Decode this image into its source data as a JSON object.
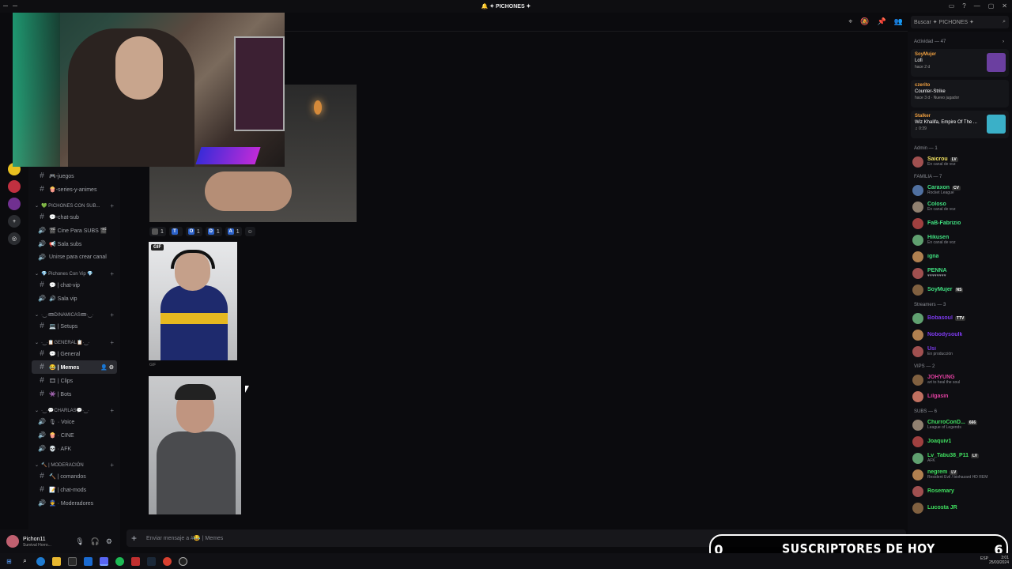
{
  "window": {
    "title": "🔔 ✦ PICHONES ✦",
    "controls": [
      "▭",
      "?",
      "—",
      "▢",
      "✕"
    ]
  },
  "search": {
    "placeholder": "Buscar ✦ PICHONES ✦"
  },
  "channels": [
    {
      "type": "text",
      "label": "🎮-juegos"
    },
    {
      "type": "text",
      "label": "🍿-series-y-animes"
    },
    {
      "type": "category",
      "label": "💚 PICHONES CON SUB..."
    },
    {
      "type": "text",
      "label": "💬-chat-sub"
    },
    {
      "type": "voice",
      "label": "🎬 Cine Para SUBS 🎬"
    },
    {
      "type": "voice",
      "label": "📢 Sala subs"
    },
    {
      "type": "voice",
      "label": "Unirse para crear canal"
    },
    {
      "type": "category",
      "label": "💎 Pichones Con Vip 💎"
    },
    {
      "type": "text",
      "label": "💬 | chat-vip"
    },
    {
      "type": "voice",
      "label": "🔊 Sala vip"
    },
    {
      "type": "category",
      "label": "·‿·🎟DINAMICAS🎟·‿·"
    },
    {
      "type": "text",
      "label": "💻 | Setups"
    },
    {
      "type": "category",
      "label": "·‿·📋GENERAL📋·‿·"
    },
    {
      "type": "text",
      "label": "💬 | General"
    },
    {
      "type": "text",
      "label": "😂 | Memes",
      "active": true
    },
    {
      "type": "text",
      "label": "🎞 | Clips"
    },
    {
      "type": "text",
      "label": "👾 | Bots"
    },
    {
      "type": "category",
      "label": "·‿·💬CHARLAS💬·‿·"
    },
    {
      "type": "voice",
      "label": "🎙 · Voice"
    },
    {
      "type": "voice",
      "label": "🍿 · CINE"
    },
    {
      "type": "voice",
      "label": "💀 · AFK"
    },
    {
      "type": "category",
      "label": "🔨 | MODERACIÓN"
    },
    {
      "type": "text",
      "label": "🔨 | comandos"
    },
    {
      "type": "text",
      "label": "📝 | chat-mods"
    },
    {
      "type": "voice",
      "label": "👮 · Moderadores"
    }
  ],
  "user": {
    "name": "Pichon11",
    "status": "Survival Horro..."
  },
  "reactions": [
    {
      "emoji": "img",
      "count": "1"
    },
    {
      "emoji": "T",
      "count": ""
    },
    {
      "emoji": "O",
      "count": "1"
    },
    {
      "emoji": "D",
      "count": "1"
    },
    {
      "emoji": "A",
      "count": "1"
    },
    {
      "emoji": "☺",
      "count": ""
    }
  ],
  "gif": {
    "badge": "GIF",
    "caption": "GIF"
  },
  "composer": {
    "placeholder": "Enviar mensaje a #😂 | Memes"
  },
  "activity": {
    "header": "Actividad — 47",
    "cards": [
      {
        "name": "SoyMujer",
        "game": "Lofi",
        "time": "hace 2 d",
        "thumb": "#6b3fa0"
      },
      {
        "name": "czerito",
        "game": "Counter-Strike",
        "time": "hace 3 d · Nuevo jugador",
        "thumb": ""
      },
      {
        "name": "Stalker",
        "game": "Wiz Khalifa, Empire Of The ...",
        "time": "♫ 0:39",
        "thumb": "#3ab0c8"
      }
    ]
  },
  "groups": [
    {
      "title": "Admin — 1",
      "members": [
        {
          "name": "Saicrou",
          "status": "En canal de voz",
          "color": "#f0e060",
          "tag": "LV"
        }
      ]
    },
    {
      "title": "FAMILIA — 7",
      "members": [
        {
          "name": "Caraxon",
          "status": "Rocket League",
          "color": "#40e080",
          "tag": "CV"
        },
        {
          "name": "Coloso",
          "status": "En canal de voz",
          "color": "#40e080",
          "tag": ""
        },
        {
          "name": "FaB-Fabrizio",
          "status": "",
          "color": "#40e080",
          "tag": ""
        },
        {
          "name": "Hikusen",
          "status": "En canal de voz",
          "color": "#40e080",
          "tag": ""
        },
        {
          "name": "igna",
          "status": "",
          "color": "#40e080",
          "tag": ""
        },
        {
          "name": "PENNA",
          "status": "♥♥♥♥♥♥♥♥",
          "color": "#40e080",
          "tag": ""
        },
        {
          "name": "SoyMujer",
          "status": "",
          "color": "#40e080",
          "tag": "NS"
        }
      ]
    },
    {
      "title": "Streamers — 3",
      "members": [
        {
          "name": "Bobasoul",
          "status": "",
          "color": "#7c3aed",
          "tag": "TTV"
        },
        {
          "name": "Nobodysoulk",
          "status": "",
          "color": "#7c3aed",
          "tag": ""
        },
        {
          "name": "Usi",
          "status": "En producción",
          "color": "#7c3aed",
          "tag": ""
        }
      ]
    },
    {
      "title": "VIPS — 2",
      "members": [
        {
          "name": "JOHYUNG",
          "status": "art to heal the soul",
          "color": "#e040a0",
          "tag": ""
        },
        {
          "name": "Lilgasin",
          "status": "",
          "color": "#e040a0",
          "tag": ""
        }
      ]
    },
    {
      "title": "SUBS — 6",
      "members": [
        {
          "name": "ChurroConD...",
          "status": "League of Legends",
          "color": "#40e060",
          "tag": "666"
        },
        {
          "name": "Joaquiv1",
          "status": "",
          "color": "#40e060",
          "tag": ""
        },
        {
          "name": "Lv_Tabu38_P11",
          "status": "AFK",
          "color": "#40e060",
          "tag": "LV"
        },
        {
          "name": "negrem",
          "status": "Resident Evil / biohazard HD REM",
          "color": "#40e060",
          "tag": "LV"
        },
        {
          "name": "Rosemary",
          "status": "",
          "color": "#40e060",
          "tag": ""
        },
        {
          "name": "Lucosta JR",
          "status": "",
          "color": "#40e060",
          "tag": ""
        }
      ]
    }
  ],
  "overlay": {
    "left": "0",
    "text": "SUSCRIPTORES DE HOY",
    "right": "6"
  },
  "tray": {
    "lang": "ESP",
    "time": "3:01",
    "date": "25/03/2024"
  }
}
